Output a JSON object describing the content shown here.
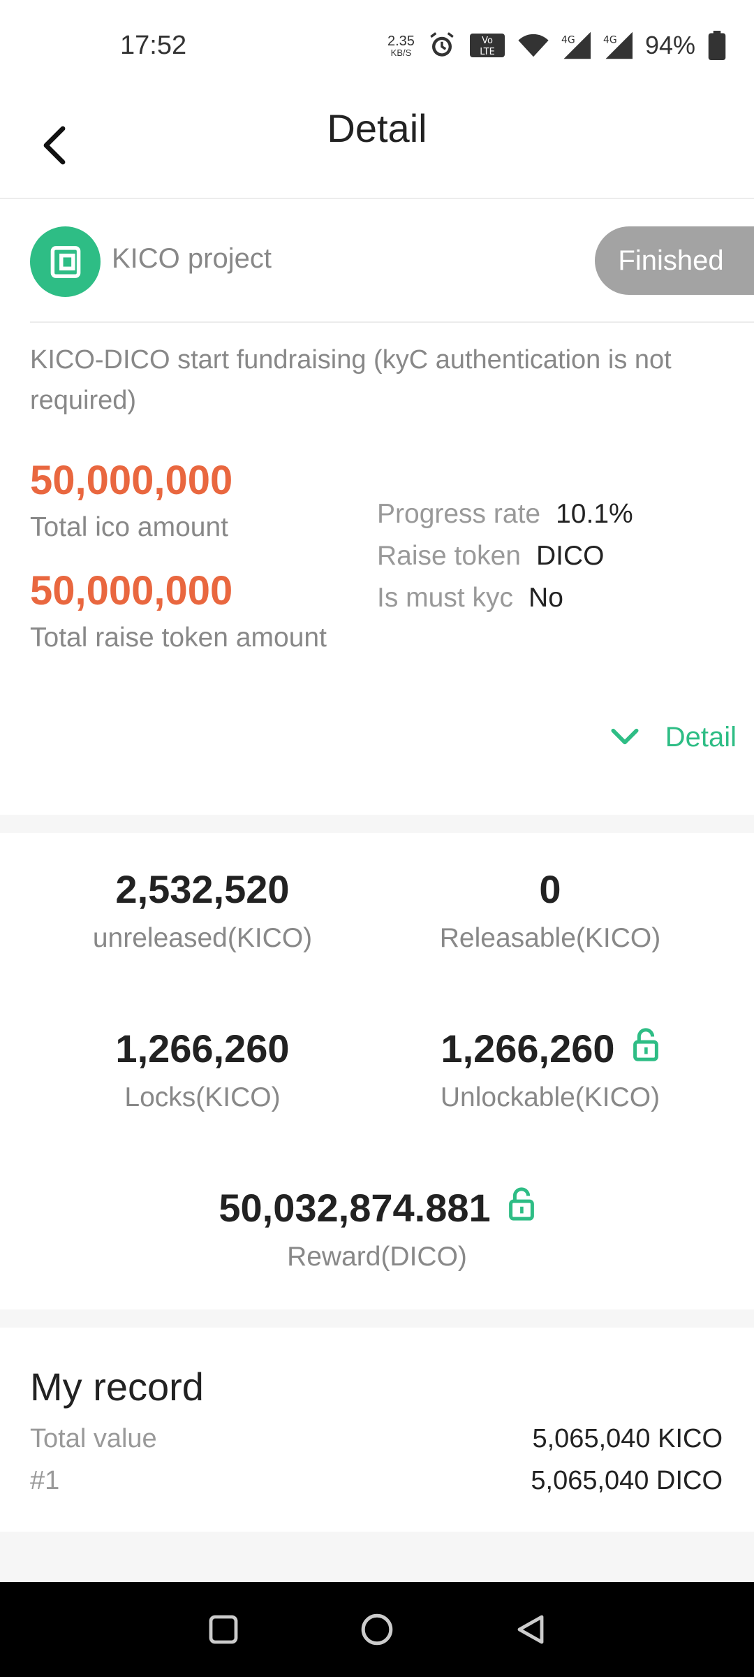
{
  "status_bar": {
    "time": "17:52",
    "net_speed_value": "2.35",
    "net_speed_unit": "KB/S",
    "battery_percent": "94%",
    "icons": [
      "alarm-icon",
      "volte-icon",
      "wifi-icon",
      "signal-4g-icon",
      "signal-4g-icon",
      "battery-icon"
    ]
  },
  "header": {
    "title": "Detail",
    "back_icon": "chevron-left-icon"
  },
  "project": {
    "name": "KICO project",
    "status": "Finished",
    "description": "KICO-DICO start fundraising (kyC authentication is not required)",
    "total_ico_amount": "50,000,000",
    "total_ico_label": "Total ico amount",
    "total_raise_amount": "50,000,000",
    "total_raise_label": "Total raise token amount",
    "info": [
      {
        "key": "Progress rate",
        "value": "10.1%"
      },
      {
        "key": "Raise token",
        "value": "DICO"
      },
      {
        "key": "Is must kyc",
        "value": "No"
      }
    ],
    "detail_toggle_label": "Detail",
    "accent_color": "#e9673f",
    "brand_color": "#2ebd85"
  },
  "stats": {
    "unreleased": {
      "value": "2,532,520",
      "label": "unreleased(KICO)"
    },
    "releasable": {
      "value": "0",
      "label": "Releasable(KICO)"
    },
    "locks": {
      "value": "1,266,260",
      "label": "Locks(KICO)"
    },
    "unlockable": {
      "value": "1,266,260",
      "label": "Unlockable(KICO)"
    },
    "reward": {
      "value": "50,032,874.881",
      "label": "Reward(DICO)"
    }
  },
  "record": {
    "title": "My record",
    "rows": [
      {
        "key": "Total value",
        "value": "5,065,040 KICO"
      },
      {
        "key": "#1",
        "value": "5,065,040 DICO"
      }
    ]
  }
}
